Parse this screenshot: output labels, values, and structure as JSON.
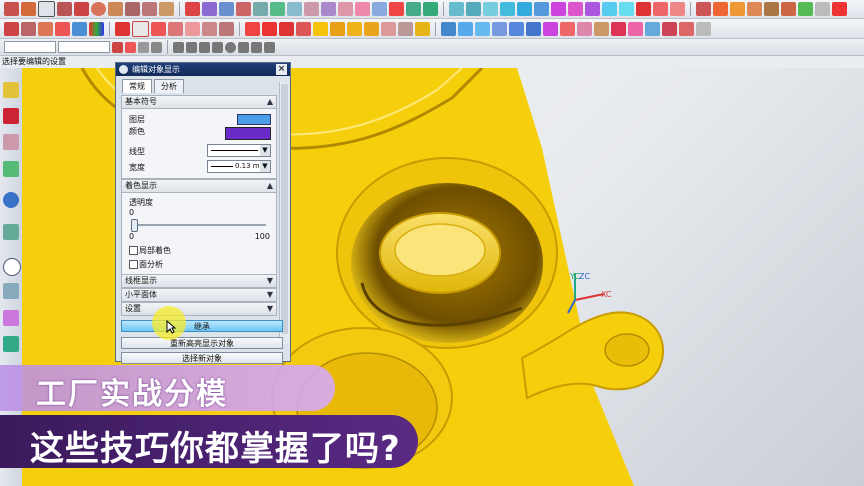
{
  "status_prompt": "选择要编辑的设置",
  "toolbar3": {
    "combo1": "",
    "combo2": ""
  },
  "dialog": {
    "title": "编辑对象显示",
    "tabs": [
      "常规",
      "分析"
    ],
    "section_basic": {
      "header": "基本符号",
      "layer_label": "图层",
      "color_label": "颜色",
      "color_value": "#6a2bc9",
      "layer_color_value": "#4a9ee8",
      "linetype_label": "线型",
      "width_label": "宽度",
      "width_value": "0.13 mm"
    },
    "section_shading": {
      "header": "着色显示",
      "transparency_label": "透明度",
      "transparency_current": "0",
      "transparency_min": "0",
      "transparency_max": "100",
      "partial_shading_label": "局部着色",
      "face_analysis_label": "面分析"
    },
    "section_wireframe": {
      "header": "线框显示"
    },
    "section_facet": {
      "header": "小平面体"
    },
    "section_settings": {
      "header": "设置"
    }
  },
  "buttons": {
    "inherit": "继承",
    "reselect": "重新高亮显示对象",
    "select_new": "选择新对象"
  },
  "axis_labels": {
    "yc": "YC",
    "zc": "ZC",
    "xc": "XC"
  },
  "captions": {
    "line1": "工厂实战分模",
    "line2": "这些技巧你都掌握了吗?"
  },
  "colors": {
    "part": "#f5cf0c",
    "part_shade": "#d9a800",
    "caption_bar": "#4a2370"
  }
}
